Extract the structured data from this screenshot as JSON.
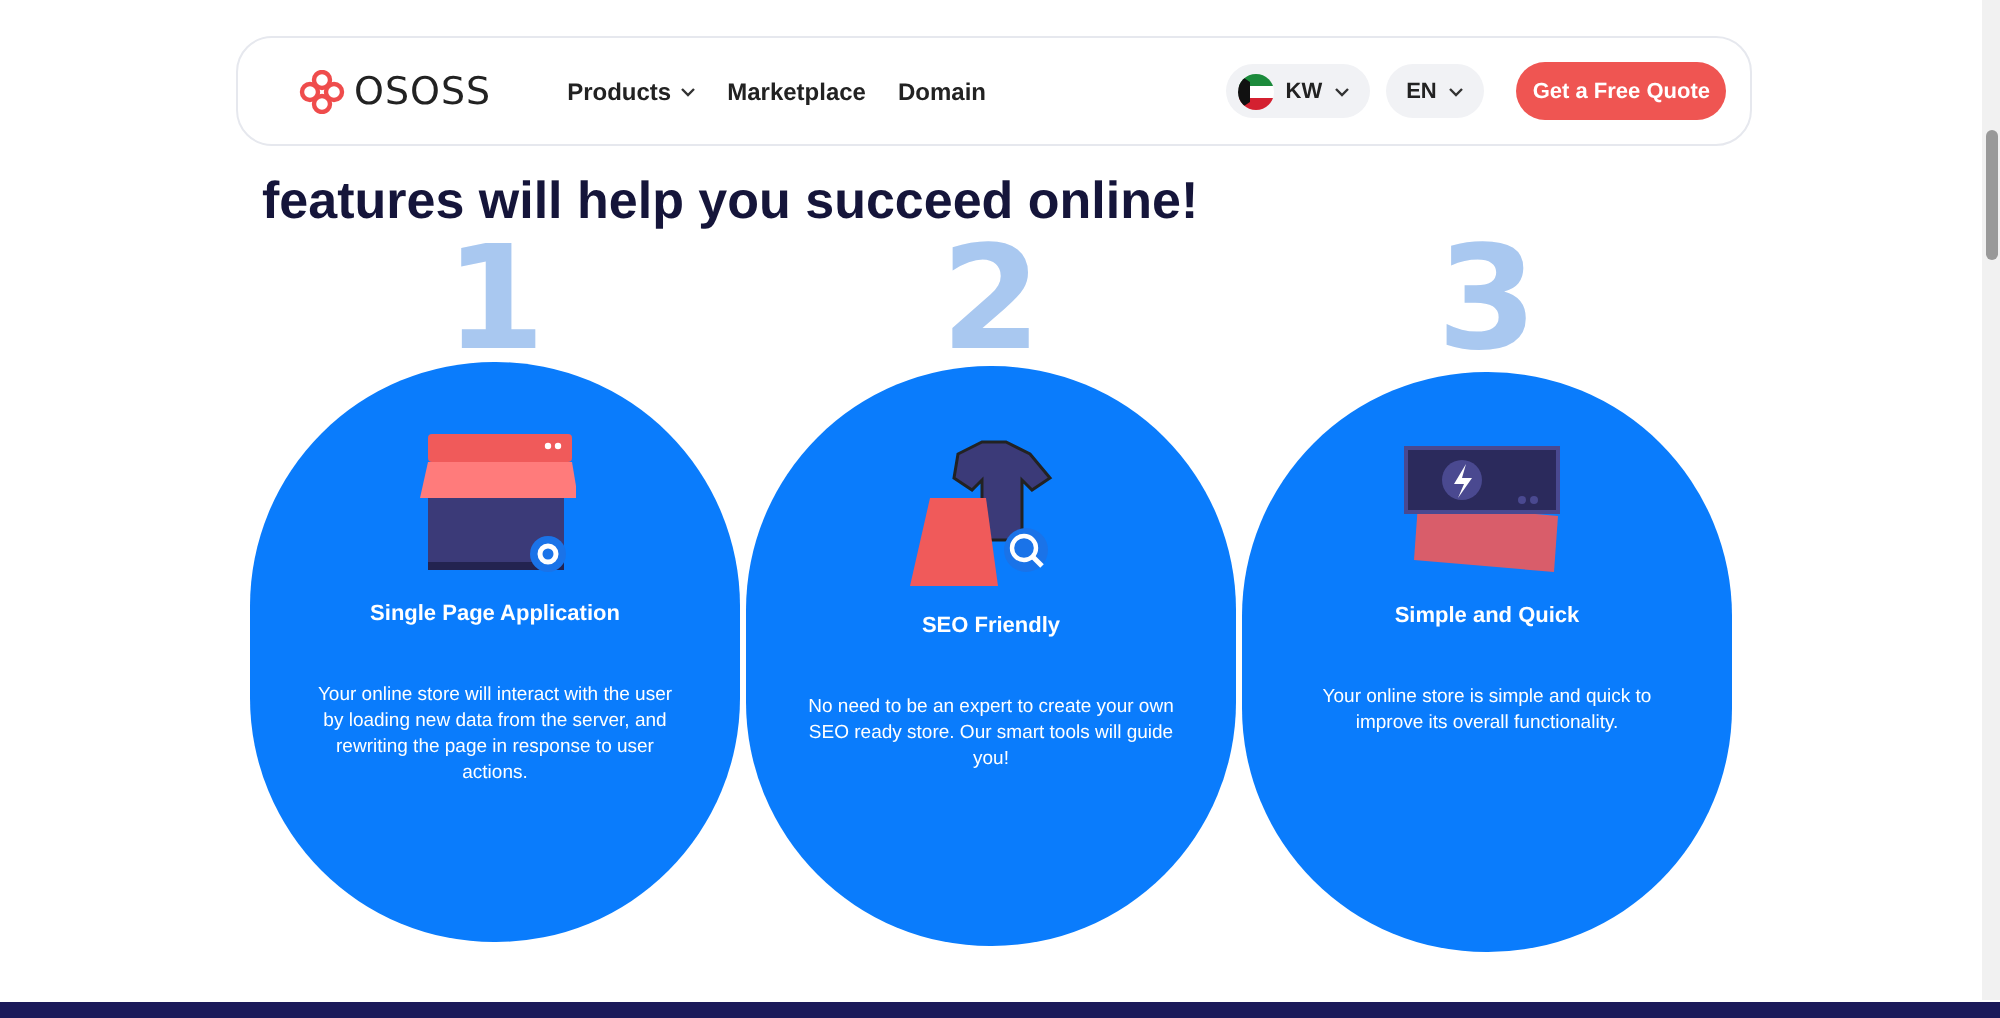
{
  "navbar": {
    "brand": "OSOSS",
    "menu": [
      {
        "label": "Products",
        "dropdown": true
      },
      {
        "label": "Marketplace",
        "dropdown": false
      },
      {
        "label": "Domain",
        "dropdown": false
      }
    ],
    "country": {
      "label": "KW"
    },
    "language": {
      "label": "EN"
    },
    "cta": "Get a Free Quote"
  },
  "heading": "features will help you succeed online!",
  "features": [
    {
      "number": "1",
      "kind": "store",
      "title": "Single Page Application",
      "text": "Your online store will interact with the user by loading new data from the server, and rewriting the page in response to user actions."
    },
    {
      "number": "2",
      "kind": "shirt",
      "title": "SEO Friendly",
      "text": "No need to be an expert to create your own SEO ready store. Our smart tools will guide you!"
    },
    {
      "number": "3",
      "kind": "bolt",
      "title": "Simple and Quick",
      "text": "Your online store is simple and quick to improve its overall functionality."
    }
  ]
}
